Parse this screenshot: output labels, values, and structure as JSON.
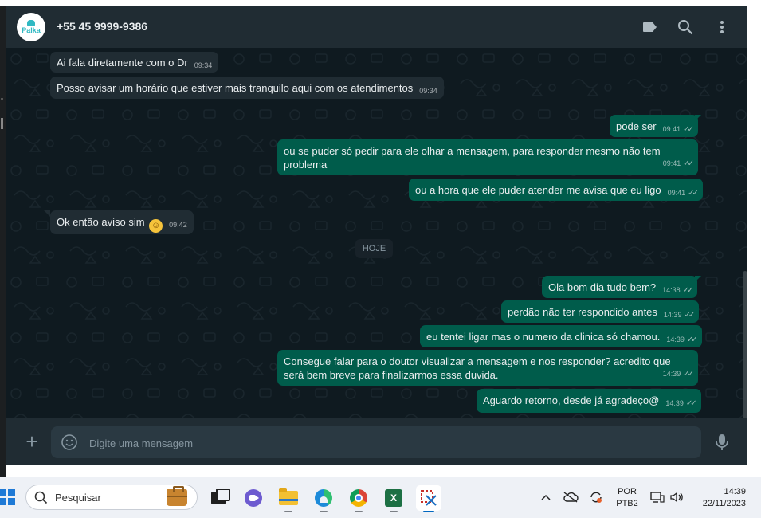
{
  "header": {
    "avatar_text": "Palka",
    "contact_name": "+55 45 9999-9386",
    "icons": [
      "label-icon",
      "search-icon",
      "menu-icon"
    ]
  },
  "messages": [
    {
      "dir": "in",
      "text": "Ai fala diretamente com o Dr",
      "time": "09:34"
    },
    {
      "dir": "in",
      "text": "Posso avisar um horário que estiver mais tranquilo aqui com os atendimentos",
      "time": "09:34"
    },
    {
      "dir": "out",
      "text": "pode ser",
      "time": "09:41"
    },
    {
      "dir": "out",
      "text": "ou se puder só pedir para ele olhar a mensagem, para responder mesmo não tem problema",
      "time": "09:41"
    },
    {
      "dir": "out",
      "text": "ou a hora que ele puder atender me avisa que eu ligo",
      "time": "09:41"
    },
    {
      "dir": "in",
      "text": "Ok então aviso sim",
      "emoji": "☺",
      "time": "09:42"
    },
    {
      "dir": "out",
      "text": "Ola bom dia tudo bem?",
      "time": "14:38"
    },
    {
      "dir": "out",
      "text": "perdão não ter respondido antes",
      "time": "14:39"
    },
    {
      "dir": "out",
      "text": "eu tentei ligar mas o numero da clinica só chamou.",
      "time": "14:39"
    },
    {
      "dir": "out",
      "text": "Consegue falar para o doutor visualizar a mensagem e nos responder? acredito que será bem breve para finalizarmos essa duvida.",
      "time": "14:39"
    },
    {
      "dir": "out",
      "text": "Aguardo retorno, desde já agradeço@",
      "time": "14:39"
    }
  ],
  "date_divider": "HOJE",
  "composer": {
    "placeholder": "Digite uma mensagem"
  },
  "taskbar": {
    "search_label": "Pesquisar",
    "lang_line1": "POR",
    "lang_line2": "PTB2",
    "time": "14:39",
    "date": "22/11/2023"
  },
  "colors": {
    "incoming_bubble": "#202c33",
    "outgoing_bubble": "#005c4b",
    "chat_bg": "#0b141a",
    "header_bg": "#202c33"
  }
}
